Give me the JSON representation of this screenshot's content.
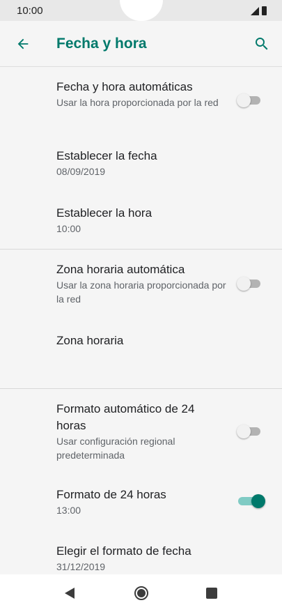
{
  "status_bar": {
    "time": "10:00",
    "icons": [
      "signal-icon",
      "battery-icon"
    ]
  },
  "app_bar": {
    "title": "Fecha y hora",
    "back_icon": "arrow-back-icon",
    "search_icon": "search-icon"
  },
  "colors": {
    "accent": "#00796b",
    "accent_track": "#80cbc4",
    "background": "#f5f5f5",
    "switch_off_thumb": "#f1f1f1",
    "switch_off_track": "#b3b3b3"
  },
  "preferences": [
    {
      "title": "Fecha y hora automáticas",
      "summary": "Usar la hora proporcionada por la red",
      "switch": "off"
    },
    {
      "title": "Establecer la fecha",
      "summary": "08/09/2019"
    },
    {
      "title": "Establecer la hora",
      "summary": "10:00"
    },
    {
      "title": "Zona horaria automática",
      "summary": "Usar la zona horaria proporcionada por la red",
      "switch": "off"
    },
    {
      "title": "Zona horaria",
      "summary": ""
    },
    {
      "title": "Formato automático de 24 horas",
      "summary": "Usar configuración regional predeterminada",
      "switch": "off"
    },
    {
      "title": "Formato de 24 horas",
      "summary": "13:00",
      "switch": "on"
    },
    {
      "title": "Elegir el formato de fecha",
      "summary": "31/12/2019"
    }
  ],
  "nav_bar": {
    "icons": [
      "nav-back-icon",
      "nav-home-icon",
      "nav-recents-icon"
    ]
  }
}
